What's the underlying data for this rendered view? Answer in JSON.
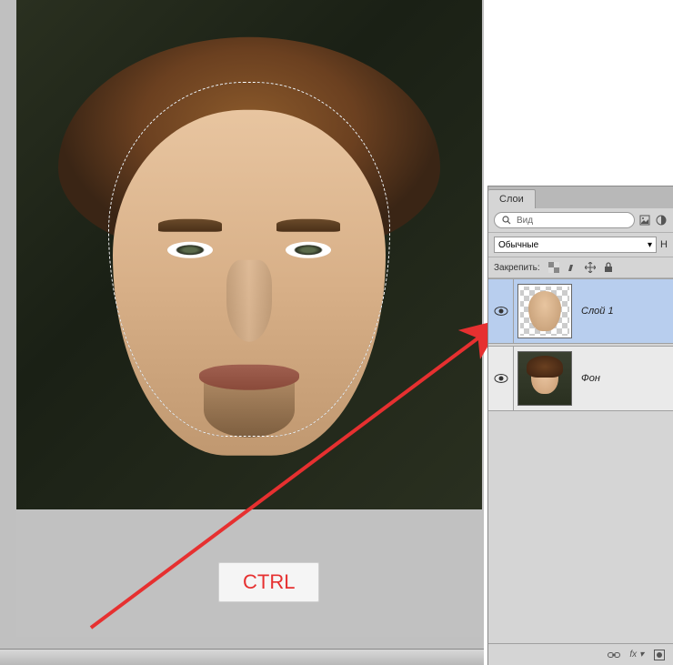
{
  "annotation": {
    "ctrl_label": "CTRL"
  },
  "layers_panel": {
    "tab_label": "Слои",
    "search_label": "Вид",
    "blend_mode": "Обычные",
    "lock_label": "Закрепить:",
    "layers": [
      {
        "name": "Слой 1",
        "visible": true,
        "selected": true
      },
      {
        "name": "Фон",
        "visible": true,
        "selected": false
      }
    ],
    "footer_fx": "fx"
  }
}
